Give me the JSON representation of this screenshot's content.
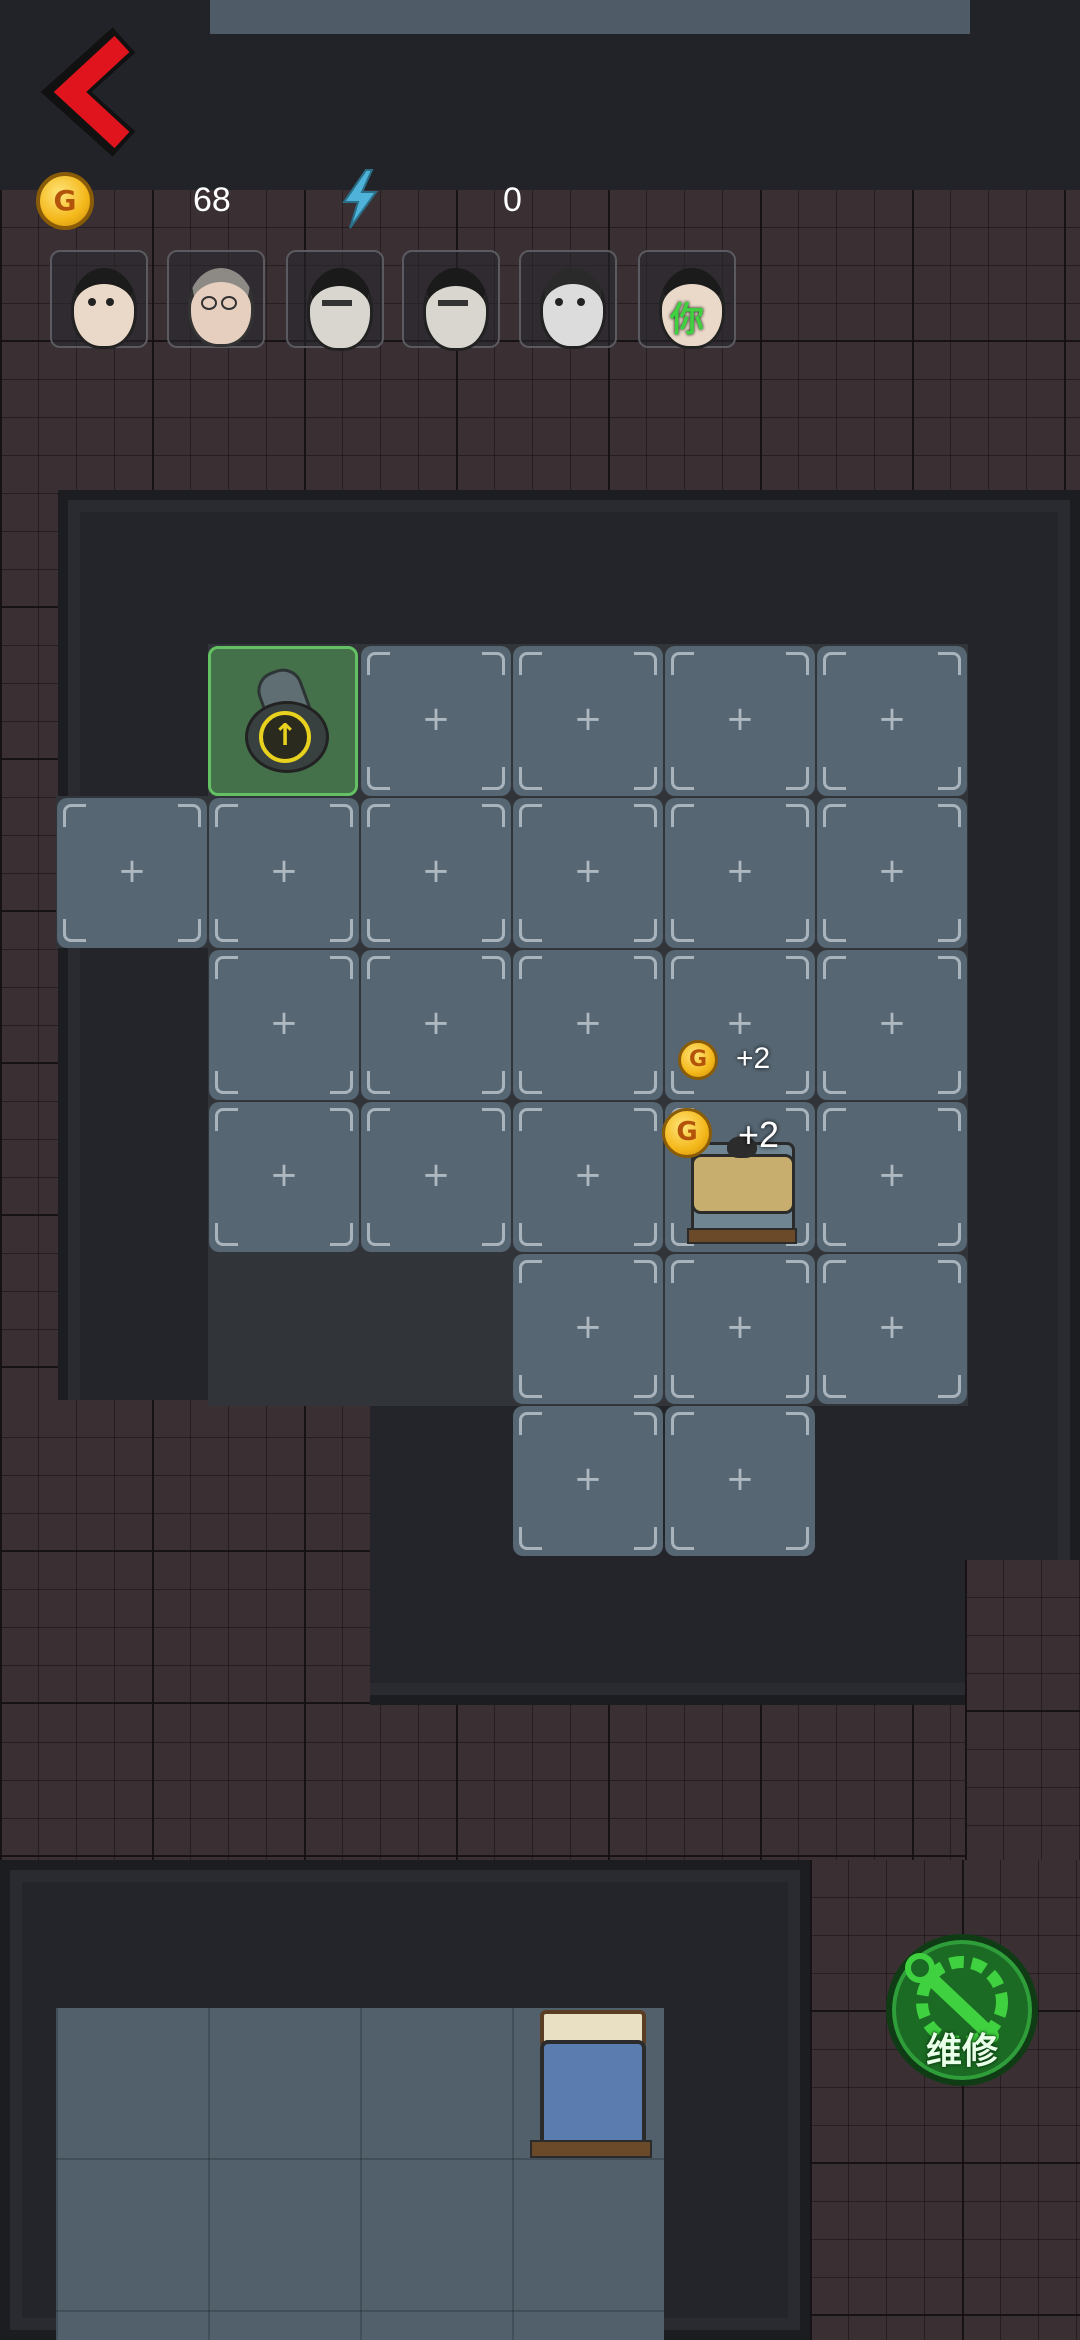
{
  "hud": {
    "gold_value": "68",
    "energy_value": "0",
    "coin_letter": "G"
  },
  "icons": {
    "back": "chevron-left-icon",
    "gold": "gold-coin-icon",
    "energy": "lightning-icon",
    "repair": "wrench-gear-icon",
    "upgrade": "arrow-up-icon",
    "bed": "bed-icon"
  },
  "players": [
    {
      "id": "p1",
      "you": false
    },
    {
      "id": "p2",
      "you": false
    },
    {
      "id": "p3",
      "you": false
    },
    {
      "id": "p4",
      "you": false
    },
    {
      "id": "p5",
      "you": false
    },
    {
      "id": "p6",
      "you": true,
      "marker": "你"
    }
  ],
  "floating_rewards": [
    {
      "coin_letter": "G",
      "text": "+2"
    },
    {
      "coin_letter": "G",
      "text": "+2"
    }
  ],
  "buttons": {
    "repair_label": "维修"
  },
  "colors": {
    "back_arrow": "#e0141c",
    "energy": "#4fb3d9",
    "repair_green": "#2f9e3a",
    "selected_tile": "#4a8a4e"
  }
}
